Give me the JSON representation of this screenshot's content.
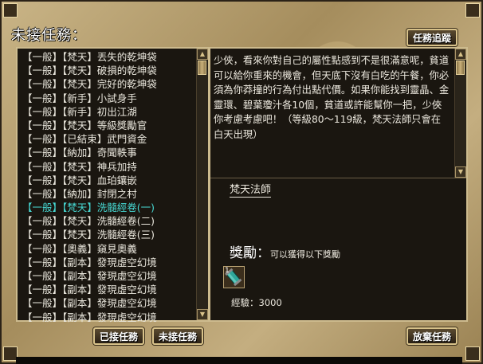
{
  "window": {
    "title": "未接任務：",
    "track_button": "任務追蹤",
    "accepted_tab": "已接任務",
    "unaccepted_tab": "未接任務",
    "abandon_button": "放棄任務"
  },
  "quests": [
    {
      "text": "【一般】【梵天】丟失的乾坤袋",
      "selected": false
    },
    {
      "text": "【一般】【梵天】破損的乾坤袋",
      "selected": false
    },
    {
      "text": "【一般】【梵天】完好的乾坤袋",
      "selected": false
    },
    {
      "text": "【一般】【新手】小試身手",
      "selected": false
    },
    {
      "text": "【一般】【新手】初出江湖",
      "selected": false
    },
    {
      "text": "【一般】【梵天】等級獎勵官",
      "selected": false
    },
    {
      "text": "【一般】【已結束】武門資金",
      "selected": false
    },
    {
      "text": "【一般】【納加】奇聞軼事",
      "selected": false
    },
    {
      "text": "【一般】【梵天】神兵加持",
      "selected": false
    },
    {
      "text": "【一般】【梵天】血珀鑲嵌",
      "selected": false
    },
    {
      "text": "【一般】【納加】封閉之村",
      "selected": false
    },
    {
      "text": "【一般】【梵天】洗髓經卷(一)",
      "selected": true
    },
    {
      "text": "【一般】【梵天】洗髓經卷(二)",
      "selected": false
    },
    {
      "text": "【一般】【梵天】洗髓經卷(三)",
      "selected": false
    },
    {
      "text": "【一般】【奧義】窺見奧義",
      "selected": false
    },
    {
      "text": "【一般】【副本】發現虛空幻境",
      "selected": false
    },
    {
      "text": "【一般】【副本】發現虛空幻境",
      "selected": false
    },
    {
      "text": "【一般】【副本】發現虛空幻境",
      "selected": false
    },
    {
      "text": "【一般】【副本】發現虛空幻境",
      "selected": false
    },
    {
      "text": "【一般】【副本】發現虛空幻境",
      "selected": false
    }
  ],
  "detail": {
    "description": "少俠，看來你對自己的屬性點感到不是很滿意呢，貧道可以給你重來的機會，但天底下沒有白吃的午餐，你必須為你莽撞的行為付出點代價。如果你能找到靈晶、金靈環、碧葉瓊汁各10個，貧道或許能幫你一把，少俠你考慮考慮吧！（等級80～119級，梵天法師只會在白天出現）",
    "npc_name": "梵天法師",
    "reward_label": "獎勵：",
    "reward_sub": "可以獲得以下獎勵",
    "item_count": "1",
    "exp_text": "經驗：3000"
  },
  "icons": {
    "scroll_up": "triangle-up",
    "scroll_down": "triangle-down",
    "reward_item": "scroll-item-icon"
  },
  "colors": {
    "selected_quest": "#46d6d1",
    "frame_gold": "#cdbb8e"
  }
}
